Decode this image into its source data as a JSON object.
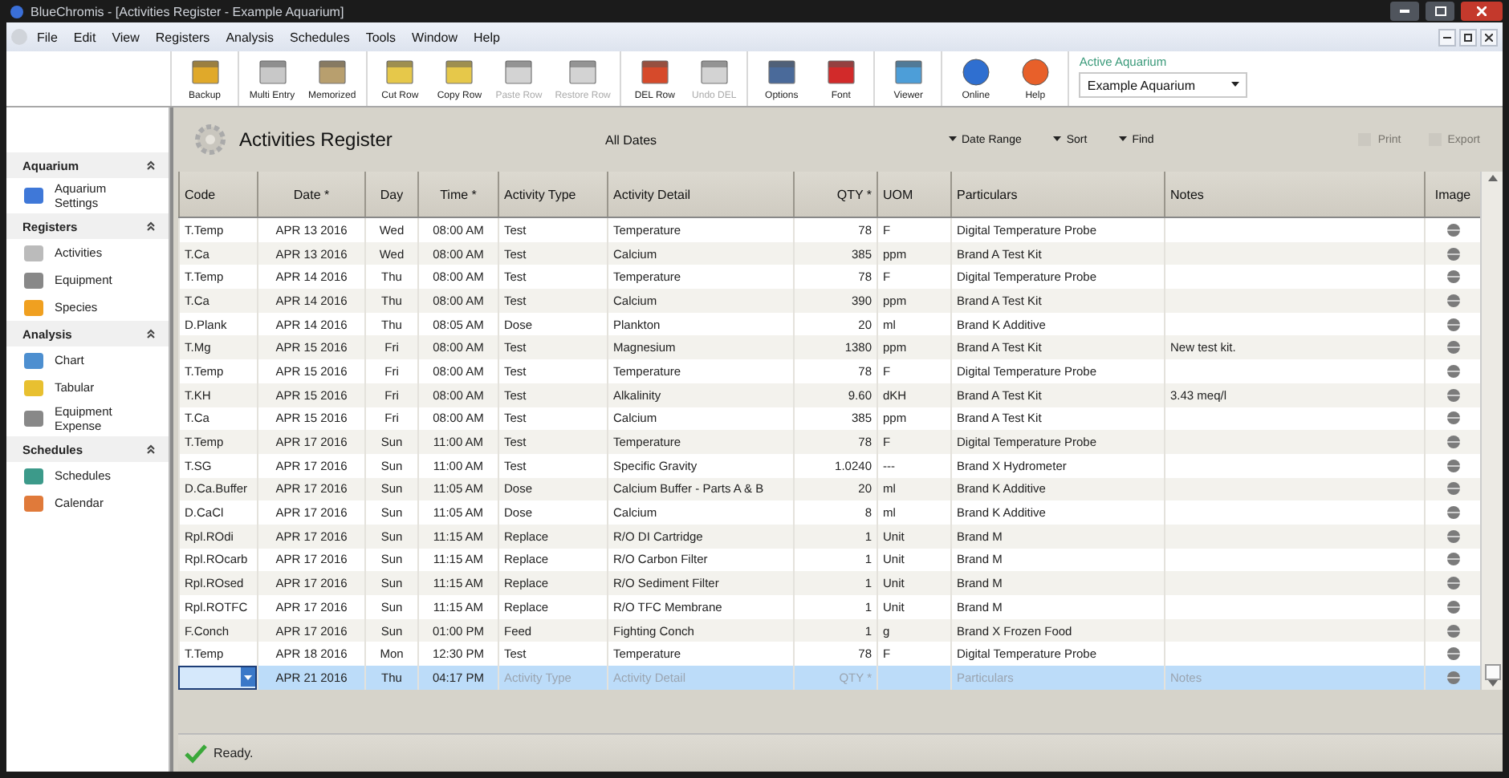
{
  "window": {
    "title": "BlueChromis - [Activities Register - Example Aquarium]"
  },
  "menu": [
    "File",
    "Edit",
    "View",
    "Registers",
    "Analysis",
    "Schedules",
    "Tools",
    "Window",
    "Help"
  ],
  "toolbar": {
    "groups": [
      [
        {
          "label": "Backup",
          "disabled": false
        }
      ],
      [
        {
          "label": "Multi Entry",
          "disabled": false
        },
        {
          "label": "Memorized",
          "disabled": false
        }
      ],
      [
        {
          "label": "Cut Row",
          "disabled": false
        },
        {
          "label": "Copy Row",
          "disabled": false
        },
        {
          "label": "Paste Row",
          "disabled": true
        },
        {
          "label": "Restore Row",
          "disabled": true
        }
      ],
      [
        {
          "label": "DEL Row",
          "disabled": false
        },
        {
          "label": "Undo DEL",
          "disabled": true
        }
      ],
      [
        {
          "label": "Options",
          "disabled": false
        },
        {
          "label": "Font",
          "disabled": false
        }
      ],
      [
        {
          "label": "Viewer",
          "disabled": false
        }
      ],
      [
        {
          "label": "Online",
          "disabled": false
        },
        {
          "label": "Help",
          "disabled": false
        }
      ]
    ]
  },
  "active_aquarium": {
    "label": "Active Aquarium",
    "value": "Example Aquarium"
  },
  "sidebar": {
    "sections": [
      {
        "title": "Aquarium",
        "expanded": true,
        "items": [
          "Aquarium Settings"
        ]
      },
      {
        "title": "Registers",
        "expanded": true,
        "items": [
          "Activities",
          "Equipment",
          "Species"
        ]
      },
      {
        "title": "Analysis",
        "expanded": true,
        "items": [
          "Chart",
          "Tabular",
          "Equipment Expense"
        ]
      },
      {
        "title": "Schedules",
        "expanded": true,
        "items": [
          "Schedules",
          "Calendar"
        ]
      }
    ]
  },
  "panel": {
    "title": "Activities Register",
    "date_filter": "All Dates",
    "menus": [
      "Date Range",
      "Sort",
      "Find"
    ],
    "actions": [
      {
        "label": "Print",
        "disabled": true
      },
      {
        "label": "Export",
        "disabled": true
      }
    ]
  },
  "table": {
    "columns": [
      "Code",
      "Date *",
      "Day",
      "Time *",
      "Activity Type",
      "Activity Detail",
      "QTY *",
      "UOM",
      "Particulars",
      "Notes",
      "Image"
    ],
    "rows": [
      {
        "code": "T.Temp",
        "date": "APR 13 2016",
        "day": "Wed",
        "time": "08:00 AM",
        "type": "Test",
        "detail": "Temperature",
        "qty": "78",
        "uom": "F",
        "particulars": "Digital Temperature Probe",
        "selected": false
      },
      {
        "code": "T.Ca",
        "date": "APR 13 2016",
        "day": "Wed",
        "time": "08:00 AM",
        "type": "Test",
        "detail": "Calcium",
        "qty": "385",
        "uom": "ppm",
        "particulars": "Brand A Test Kit",
        "selected": false
      },
      {
        "code": "T.Temp",
        "date": "APR 14 2016",
        "day": "Thu",
        "time": "08:00 AM",
        "type": "Test",
        "detail": "Temperature",
        "qty": "78",
        "uom": "F",
        "particulars": "Digital Temperature Probe",
        "selected": false
      },
      {
        "code": "T.Ca",
        "date": "APR 14 2016",
        "day": "Thu",
        "time": "08:00 AM",
        "type": "Test",
        "detail": "Calcium",
        "qty": "390",
        "uom": "ppm",
        "particulars": "Brand A Test Kit",
        "selected": false
      },
      {
        "code": "D.Plank",
        "date": "APR 14 2016",
        "day": "Thu",
        "time": "08:05 AM",
        "type": "Dose",
        "detail": "Plankton",
        "qty": "20",
        "uom": "ml",
        "particulars": "Brand K Additive",
        "selected": false
      },
      {
        "code": "T.Mg",
        "date": "APR 15 2016",
        "day": "Fri",
        "time": "08:00 AM",
        "type": "Test",
        "detail": "Magnesium",
        "qty": "1380",
        "uom": "ppm",
        "particulars": "Brand A Test Kit",
        "notes": "New test kit.",
        "selected": false
      },
      {
        "code": "T.Temp",
        "date": "APR 15 2016",
        "day": "Fri",
        "time": "08:00 AM",
        "type": "Test",
        "detail": "Temperature",
        "qty": "78",
        "uom": "F",
        "particulars": "Digital Temperature Probe",
        "selected": false
      },
      {
        "code": "T.KH",
        "date": "APR 15 2016",
        "day": "Fri",
        "time": "08:00 AM",
        "type": "Test",
        "detail": "Alkalinity",
        "qty": "9.60",
        "uom": "dKH",
        "particulars": "Brand A Test Kit",
        "notes": "3.43 meq/l",
        "selected": false
      },
      {
        "code": "T.Ca",
        "date": "APR 15 2016",
        "day": "Fri",
        "time": "08:00 AM",
        "type": "Test",
        "detail": "Calcium",
        "qty": "385",
        "uom": "ppm",
        "particulars": "Brand A Test Kit",
        "selected": false
      },
      {
        "code": "T.Temp",
        "date": "APR 17 2016",
        "day": "Sun",
        "time": "11:00 AM",
        "type": "Test",
        "detail": "Temperature",
        "qty": "78",
        "uom": "F",
        "particulars": "Digital Temperature Probe",
        "selected": false
      },
      {
        "code": "T.SG",
        "date": "APR 17 2016",
        "day": "Sun",
        "time": "11:00 AM",
        "type": "Test",
        "detail": "Specific Gravity",
        "qty": "1.0240",
        "uom": "---",
        "particulars": "Brand X Hydrometer",
        "selected": false
      },
      {
        "code": "D.Ca.Buffer",
        "date": "APR 17 2016",
        "day": "Sun",
        "time": "11:05 AM",
        "type": "Dose",
        "detail": "Calcium Buffer - Parts A & B",
        "qty": "20",
        "uom": "ml",
        "particulars": "Brand K Additive",
        "selected": false
      },
      {
        "code": "D.CaCl",
        "date": "APR 17 2016",
        "day": "Sun",
        "time": "11:05 AM",
        "type": "Dose",
        "detail": "Calcium",
        "qty": "8",
        "uom": "ml",
        "particulars": "Brand K Additive",
        "selected": false
      },
      {
        "code": "Rpl.ROdi",
        "date": "APR 17 2016",
        "day": "Sun",
        "time": "11:15 AM",
        "type": "Replace",
        "detail": "R/O DI Cartridge",
        "qty": "1",
        "uom": "Unit",
        "particulars": "Brand M",
        "selected": false
      },
      {
        "code": "Rpl.ROcarb",
        "date": "APR 17 2016",
        "day": "Sun",
        "time": "11:15 AM",
        "type": "Replace",
        "detail": "R/O Carbon Filter",
        "qty": "1",
        "uom": "Unit",
        "particulars": "Brand M",
        "selected": false
      },
      {
        "code": "Rpl.ROsed",
        "date": "APR 17 2016",
        "day": "Sun",
        "time": "11:15 AM",
        "type": "Replace",
        "detail": "R/O Sediment Filter",
        "qty": "1",
        "uom": "Unit",
        "particulars": "Brand M",
        "selected": false
      },
      {
        "code": "Rpl.ROTFC",
        "date": "APR 17 2016",
        "day": "Sun",
        "time": "11:15 AM",
        "type": "Replace",
        "detail": "R/O TFC Membrane",
        "qty": "1",
        "uom": "Unit",
        "particulars": "Brand M",
        "selected": false
      },
      {
        "code": "F.Conch",
        "date": "APR 17 2016",
        "day": "Sun",
        "time": "01:00 PM",
        "type": "Feed",
        "detail": "Fighting Conch",
        "qty": "1",
        "uom": "g",
        "particulars": "Brand X Frozen Food",
        "selected": false
      },
      {
        "code": "T.Temp",
        "date": "APR 18 2016",
        "day": "Mon",
        "time": "12:30 PM",
        "type": "Test",
        "detail": "Temperature",
        "qty": "78",
        "uom": "F",
        "particulars": "Digital Temperature Probe",
        "selected": false
      }
    ],
    "new_row": {
      "date": "APR 21 2016",
      "day": "Thu",
      "time": "04:17 PM",
      "placeholders": {
        "type": "Activity Type",
        "detail": "Activity Detail",
        "qty": "QTY *",
        "particulars": "Particulars",
        "notes": "Notes"
      },
      "selected": true
    }
  },
  "status_bar": {
    "text": "Ready."
  }
}
